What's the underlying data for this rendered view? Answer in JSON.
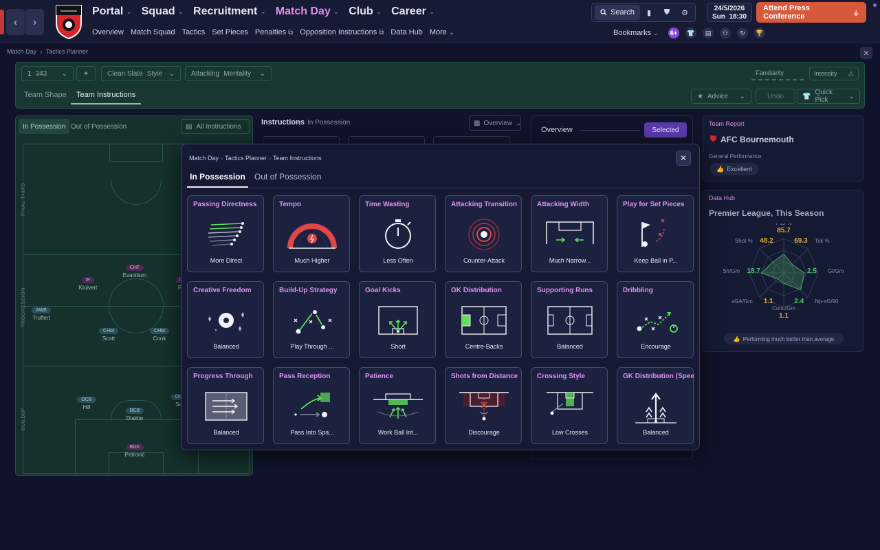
{
  "nav": {
    "back": "‹",
    "forward": "›",
    "main": [
      {
        "label": "Portal",
        "active": false
      },
      {
        "label": "Squad",
        "active": false
      },
      {
        "label": "Recruitment",
        "active": false
      },
      {
        "label": "Match Day",
        "active": true
      },
      {
        "label": "Club",
        "active": false
      },
      {
        "label": "Career",
        "active": false
      }
    ],
    "sub": [
      {
        "label": "Overview",
        "ext": false
      },
      {
        "label": "Match Squad",
        "ext": false
      },
      {
        "label": "Tactics",
        "ext": false
      },
      {
        "label": "Set Pieces",
        "ext": false
      },
      {
        "label": "Penalties",
        "ext": true
      },
      {
        "label": "Opposition Instructions",
        "ext": true
      },
      {
        "label": "Data Hub",
        "ext": false
      },
      {
        "label": "More",
        "ext": false
      }
    ]
  },
  "toolbar": {
    "search": "Search",
    "date": "24/5/2026",
    "day": "Sun",
    "time": "18:30",
    "press": "Attend Press Conference",
    "bookmarks": "Bookmarks",
    "badge": "6+"
  },
  "breadcrumb": {
    "a": "Match Day",
    "b": "Tactics Planner"
  },
  "planner": {
    "formation_num": "1",
    "formation": "343",
    "add": "+",
    "style_value": "Clean Slate",
    "style_label": "Style",
    "mentality_value": "Attacking",
    "mentality_label": "Mentality",
    "familiarity": "Familiarity",
    "intensity": "Intensity",
    "tab_shape": "Team Shape",
    "tab_instr": "Team Instructions",
    "advice": "Advice",
    "undo": "Undo",
    "quickpick": "Quick Pick"
  },
  "pitch": {
    "tab_in": "In Possession",
    "tab_out": "Out of Possession",
    "all_instr": "All Instructions",
    "zones": [
      "FINAL THIRD",
      "PROGRESSION",
      "BUILDUP"
    ],
    "players": [
      {
        "pos": "CHF",
        "name": "Evanilson",
        "att": true
      },
      {
        "pos": "IF",
        "name": "Kluivert",
        "att": true
      },
      {
        "pos": "IF",
        "name": "Ro",
        "att": true
      },
      {
        "pos": "AWB",
        "name": "Truffert",
        "att": false
      },
      {
        "pos": "CHM",
        "name": "Scott",
        "att": false
      },
      {
        "pos": "CHM",
        "name": "Cook",
        "att": false
      },
      {
        "pos": "OCB",
        "name": "Hill",
        "att": false
      },
      {
        "pos": "BCB",
        "name": "Diakite",
        "att": false
      },
      {
        "pos": "OC",
        "name": "Se",
        "att": false
      },
      {
        "pos": "BGK",
        "name": "Petrović",
        "att": false
      }
    ]
  },
  "instructions": {
    "title": "Instructions",
    "sub": "In Possession",
    "overview_select": "Overview"
  },
  "overview": {
    "title": "Overview",
    "selected": "Selected"
  },
  "team_report": {
    "label": "Team Report",
    "name": "AFC Bournemouth",
    "perf_label": "General Performance",
    "perf_value": "Excellent"
  },
  "data_hub": {
    "label": "Data Hub",
    "title": "Premier League, This Season",
    "footer": "Performing much better than average",
    "stats": [
      {
        "label": "Pas %",
        "value": "85.7",
        "color": "#e0a83a"
      },
      {
        "label": "Tck %",
        "value": "69.3",
        "color": "#e0a83a"
      },
      {
        "label": "Gl/Gm",
        "value": "2.5",
        "color": "#4ac06a"
      },
      {
        "label": "Np-xG/90",
        "value": "2.4",
        "color": "#4ac06a"
      },
      {
        "label": "Conc/Gm",
        "value": "1.1",
        "color": "#e0a83a"
      },
      {
        "label": "xGA/Gm",
        "value": "1.1",
        "color": "#e0a83a"
      },
      {
        "label": "Sh/Gm",
        "value": "18.7",
        "color": "#4ac06a"
      },
      {
        "label": "Shot %",
        "value": "48.2",
        "color": "#e0a83a"
      }
    ]
  },
  "overlay": {
    "breadcrumb": [
      "Match Day",
      "Tactics Planner",
      "Team Instructions"
    ],
    "tabs": [
      "In Possession",
      "Out of Possession"
    ],
    "close": "✕",
    "cards": [
      {
        "title": "Passing Directness",
        "value": "More Direct",
        "icon": "passing-directness"
      },
      {
        "title": "Tempo",
        "value": "Much Higher",
        "icon": "tempo-gauge"
      },
      {
        "title": "Time Wasting",
        "value": "Less Often",
        "icon": "stopwatch"
      },
      {
        "title": "Attacking Transition",
        "value": "Counter-Attack",
        "icon": "counter-attack-target"
      },
      {
        "title": "Attacking Width",
        "value": "Much Narrow...",
        "icon": "attacking-width"
      },
      {
        "title": "Play for Set Pieces",
        "value": "Keep Ball in P...",
        "icon": "corner-flag"
      },
      {
        "title": "Creative Freedom",
        "value": "Balanced",
        "icon": "sparkle-ball"
      },
      {
        "title": "Build-Up Strategy",
        "value": "Play Through ...",
        "icon": "build-up-strategy"
      },
      {
        "title": "Goal Kicks",
        "value": "Short",
        "icon": "goal-kicks"
      },
      {
        "title": "GK Distribution",
        "value": "Centre-Backs",
        "icon": "gk-distribution"
      },
      {
        "title": "Supporting Runs",
        "value": "Balanced",
        "icon": "supporting-runs"
      },
      {
        "title": "Dribbling",
        "value": "Encourage",
        "icon": "dribbling"
      },
      {
        "title": "Progress Through",
        "value": "Balanced",
        "icon": "progress-through"
      },
      {
        "title": "Pass Reception",
        "value": "Pass Into Spa...",
        "icon": "pass-reception"
      },
      {
        "title": "Patience",
        "value": "Work Ball Int...",
        "icon": "patience"
      },
      {
        "title": "Shots from Distance",
        "value": "Discourage",
        "icon": "shots-from-distance"
      },
      {
        "title": "Crossing Style",
        "value": "Low Crosses",
        "icon": "crossing-style"
      },
      {
        "title": "GK Distribution (Speed)",
        "value": "Balanced",
        "icon": "gk-distribution-speed"
      }
    ]
  }
}
